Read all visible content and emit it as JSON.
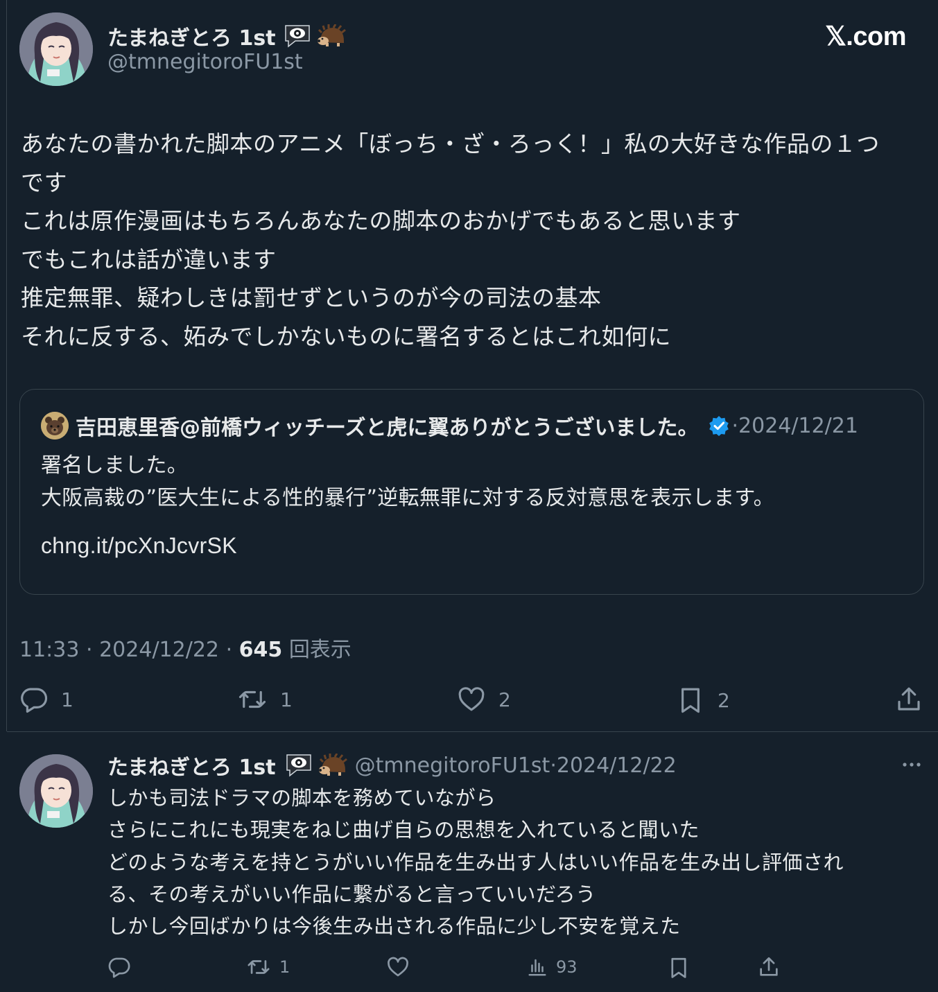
{
  "brand": "𝕏.com",
  "main_tweet": {
    "display_name": "たまねぎとろ 1st",
    "handle": "@tmnegitoroFU1st",
    "body_lines": [
      "あなたの書かれた脚本のアニメ「ぼっち・ざ・ろっく！」私の大好きな作品の１つ",
      "です",
      "これは原作漫画はもちろんあなたの脚本のおかげでもあると思います",
      "でもこれは話が違います",
      "推定無罪、疑わしきは罰せずというのが今の司法の基本",
      "それに反する、妬みでしかないものに署名するとはこれ如何に"
    ],
    "quote": {
      "display_name": "吉田恵里香@前橋ウィッチーズと虎に翼ありがとうございました。",
      "date": "2024/12/21",
      "body_lines": [
        "署名しました。",
        "大阪高裁の”医大生による性的暴行”逆転無罪に対する反対意思を表示します。"
      ],
      "link": "chng.it/pcXnJcvrSK"
    },
    "time": "11:33",
    "date": "2024/12/22",
    "views_count": "645",
    "views_label": "回表示",
    "actions": {
      "reply_count": "1",
      "retweet_count": "1",
      "like_count": "2",
      "bookmark_count": "2"
    }
  },
  "reply_tweet": {
    "display_name": "たまねぎとろ 1st",
    "handle": "@tmnegitoroFU1st",
    "date": "2024/12/22",
    "body_lines": [
      "しかも司法ドラマの脚本を務めていながら",
      "さらにこれにも現実をねじ曲げ自らの思想を入れていると聞いた",
      "どのような考えを持とうがいい作品を生み出す人はいい作品を生み出し評価され",
      "る、その考えがいい作品に繋がると言っていいだろう",
      "しかし今回ばかりは今後生み出される作品に少し不安を覚えた"
    ],
    "actions": {
      "retweet_count": "1",
      "views_count": "93"
    }
  },
  "colors": {
    "background": "#15202b",
    "text": "#e7e9ea",
    "muted": "#8b98a5",
    "border": "#38444d",
    "verified": "#1d9bf0"
  }
}
